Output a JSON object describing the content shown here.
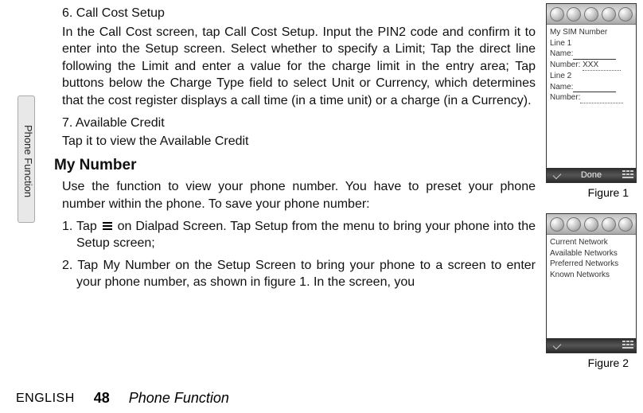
{
  "sideTab": "Phone Function",
  "main": {
    "h6a": "6. Call Cost Setup",
    "p1": "In the Call Cost screen, tap Call Cost Setup. Input the PIN2 code and confirm it to enter into the Setup screen. Select whether to specify a Limit; Tap the direct line following the Limit and enter a value for the charge limit in the entry area; Tap buttons below the Charge Type field to select Unit or Currency, which determines that the cost register displays a call time (in a time unit) or a charge (in a Currency).",
    "h7a": "7. Available Credit",
    "p2": "Tap it to view the Available Credit",
    "myNumber": "My Number",
    "p3": "Use the function to view your phone number. You have to preset your phone number within the phone. To save your phone number:",
    "li1a": "1. Tap ",
    "li1b": " on Dialpad Screen. Tap Setup from the menu to bring your phone into the Setup screen;",
    "li2": "2. Tap My Number on the Setup Screen to bring your phone to a screen to enter your phone number, as shown in figure 1. In the screen, you"
  },
  "footer": {
    "lang": "ENGLISH",
    "page": "48",
    "chapter": "Phone Function"
  },
  "panel1": {
    "title": "My SIM Number",
    "line1": "Line 1",
    "nameLbl": "Name:",
    "numberLbl": "Number:",
    "numberVal": "XXX",
    "line2": "Line 2",
    "done": "Done"
  },
  "panel2": {
    "items": {
      "0": "Current Network",
      "1": "Available Networks",
      "2": "Preferred Networks",
      "3": "Known Networks"
    }
  },
  "captions": {
    "f1": "Figure 1",
    "f2": "Figure 2"
  }
}
